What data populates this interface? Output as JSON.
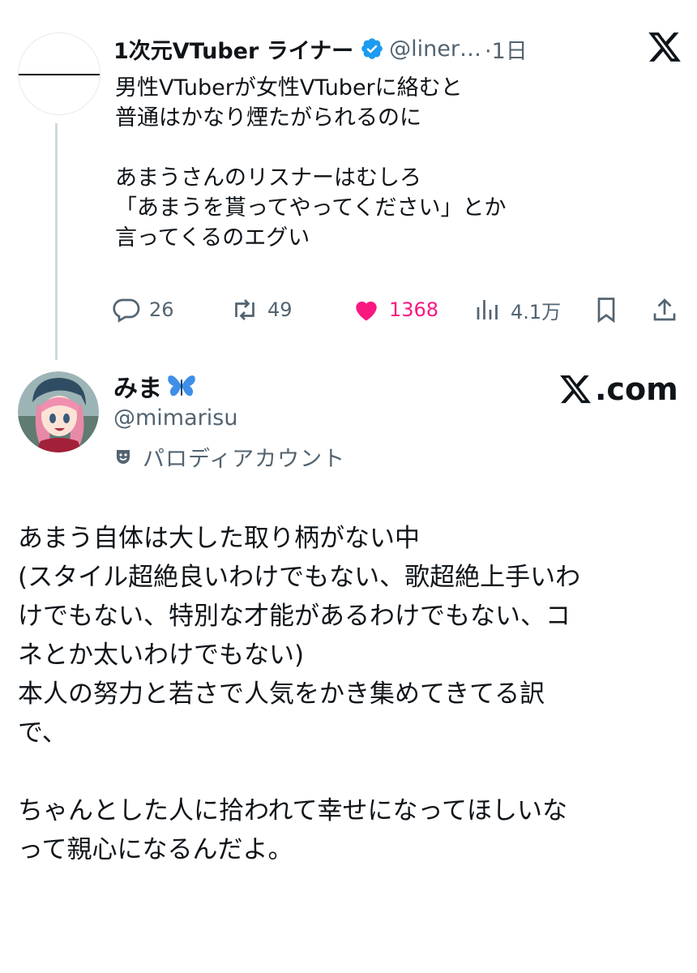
{
  "tweet": {
    "author_name": "1次元VTuber ライナー",
    "handle": "@liner…",
    "time": "·1日",
    "text": "男性VTuberが女性VTuberに絡むと\n普通はかなり煙たがられるのに\n\nあまうさんのリスナーはむしろ\n「あまうを貰ってやってください」とか\n言ってくるのエグい",
    "stats": {
      "replies": "26",
      "reposts": "49",
      "likes": "1368",
      "views": "4.1万"
    }
  },
  "quoted": {
    "name": "みま",
    "handle": "@mimarisu",
    "label": "パロディアカウント",
    "source": ".com",
    "text": "あまう自体は大した取り柄がない中\n(スタイル超絶良いわけでもない、歌超絶上手いわ\nけでもない、特別な才能があるわけでもない、コ\nネとか太いわけでもない)\n本人の努力と若さで人気をかき集めてきてる訳\nで、\n\nちゃんとした人に拾われて幸せになってほしいな\nって親心になるんだよ。"
  },
  "icons": [
    "verified-badge-icon",
    "x-logo-icon",
    "reply-icon",
    "repost-icon",
    "like-icon",
    "views-icon",
    "bookmark-icon",
    "share-icon",
    "butterfly-emoji-icon",
    "parody-mask-icon"
  ],
  "colors": {
    "text": "#0f1419",
    "muted": "#536471",
    "like": "#f91880",
    "verified": "#1d9bf0",
    "thread_line": "#cfd9de"
  }
}
